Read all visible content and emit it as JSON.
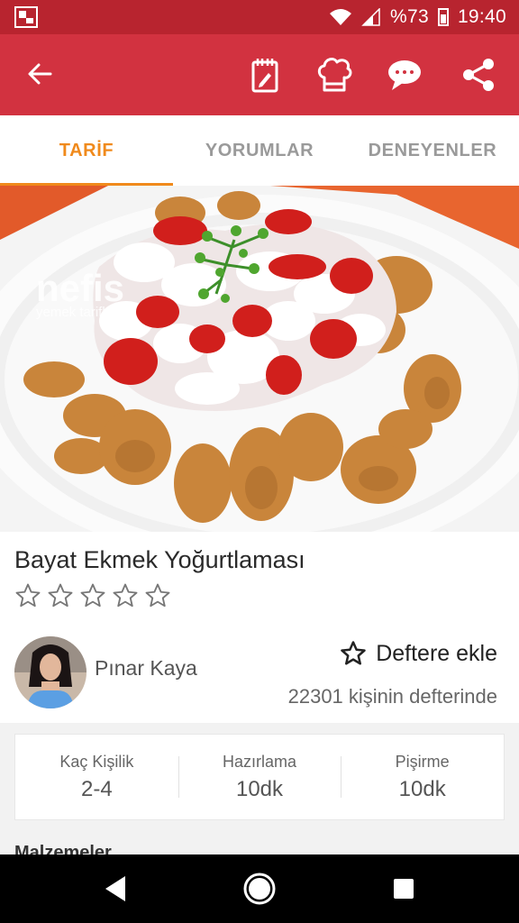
{
  "status_bar": {
    "battery_text": "%73",
    "time": "19:40",
    "icons": [
      "app-notification-icon",
      "wifi-icon",
      "signal-icon",
      "battery-icon"
    ]
  },
  "toolbar": {
    "back_icon": "arrow-left-icon",
    "actions": [
      "notebook-icon",
      "chef-hat-icon",
      "comment-icon",
      "share-icon"
    ],
    "color": "#d23240"
  },
  "tabs": [
    {
      "label": "TARİF",
      "active": true
    },
    {
      "label": "YORUMLAR",
      "active": false
    },
    {
      "label": "DENEYENLER",
      "active": false
    }
  ],
  "hero": {
    "watermark_line1": "nefis",
    "watermark_line2": "yemek tarifleri"
  },
  "recipe": {
    "title": "Bayat Ekmek Yoğurtlaması",
    "rating": 0,
    "rating_max": 5,
    "author": "Pınar Kaya",
    "add_to_book": "Deftere ekle",
    "book_count": "22301 kişinin defterinde"
  },
  "info": [
    {
      "label": "Kaç Kişilik",
      "value": "2-4"
    },
    {
      "label": "Hazırlama",
      "value": "10dk"
    },
    {
      "label": "Pişirme",
      "value": "10dk"
    }
  ],
  "next_section": "Malzemeler",
  "colors": {
    "status_bar": "#b8242f",
    "accent": "#f08a1c"
  }
}
